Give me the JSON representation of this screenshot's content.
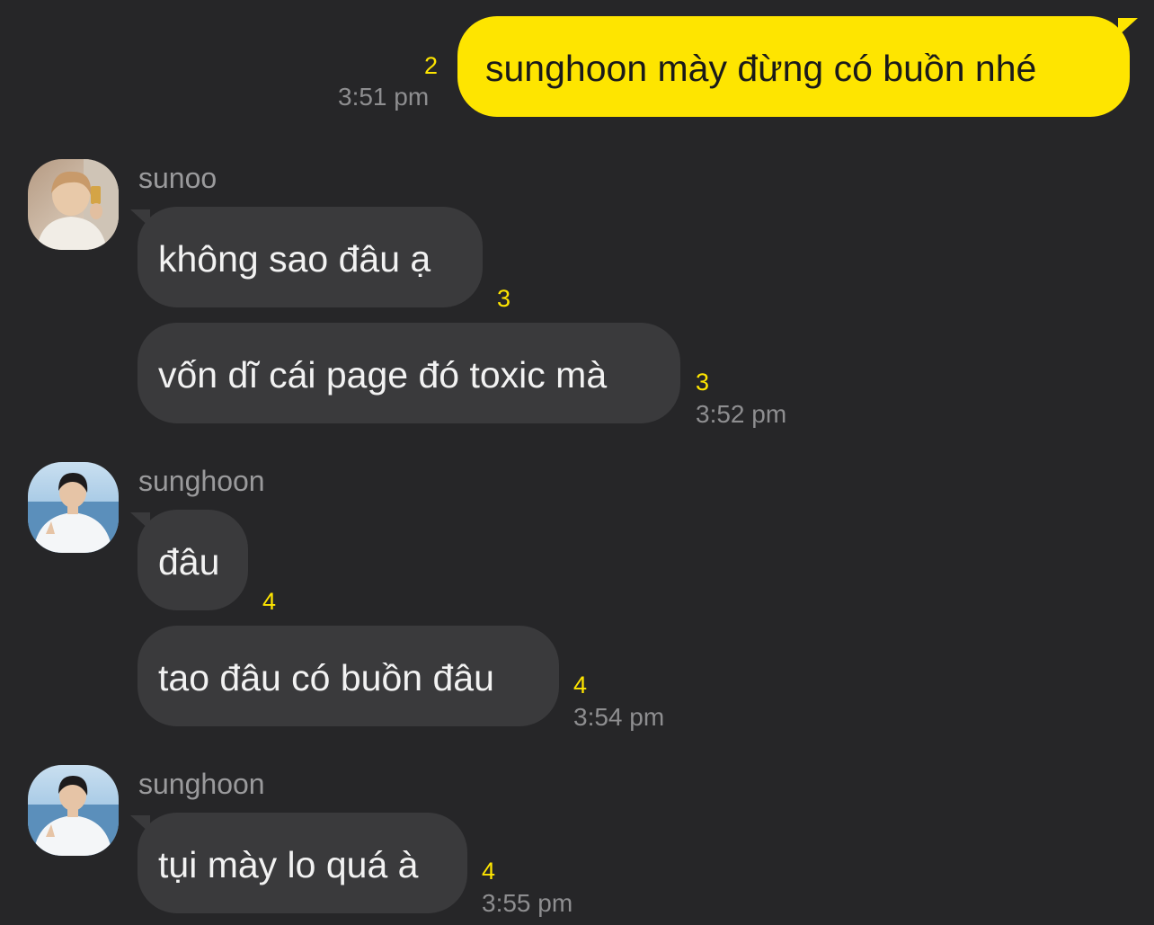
{
  "colors": {
    "background": "#262628",
    "incoming_bubble": "#3a3a3c",
    "outgoing_bubble": "#fee500",
    "unread_count": "#fee500",
    "timestamp": "#8e8e90",
    "sender_name": "#9a9a9c"
  },
  "messages": {
    "m1": {
      "text": "sunghoon mày đừng có buồn nhé",
      "unread": "2",
      "time": "3:51 pm"
    },
    "g1": {
      "sender": "sunoo",
      "avatar": "profile-photo",
      "m1": {
        "text": "không sao đâu ạ",
        "unread": "3"
      },
      "m2": {
        "text": "vốn dĩ cái page đó toxic mà",
        "unread": "3",
        "time": "3:52 pm"
      }
    },
    "g2": {
      "sender": "sunghoon",
      "avatar": "profile-photo",
      "m1": {
        "text": "đâu",
        "unread": "4"
      },
      "m2": {
        "text": "tao đâu có buồn đâu",
        "unread": "4",
        "time": "3:54 pm"
      }
    },
    "g3": {
      "sender": "sunghoon",
      "avatar": "profile-photo",
      "m1": {
        "text": "tụi mày lo quá à",
        "unread": "4",
        "time": "3:55 pm"
      }
    }
  }
}
